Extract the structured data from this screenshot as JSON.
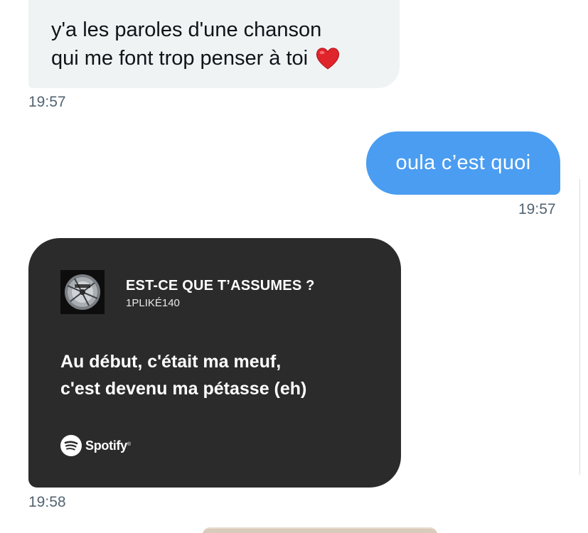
{
  "messages": [
    {
      "direction": "incoming",
      "lines": [
        "y'a les paroles d'une chanson",
        "qui me font trop penser à toi"
      ],
      "emoji": "heart-icon",
      "time": "19:57"
    },
    {
      "direction": "outgoing",
      "text": "oula c’est quoi",
      "time": "19:57"
    },
    {
      "direction": "incoming",
      "type": "spotify-lyrics-card",
      "track_title": "EST-CE QUE T’ASSUMES ?",
      "artist": "1PLIKÉ140",
      "lyrics": [
        "Au début, c'était ma meuf,",
        "c'est devenu ma pétasse (eh)"
      ],
      "brand": "Spotify",
      "brand_mark": "®",
      "time": "19:58"
    }
  ],
  "colors": {
    "incoming_bubble": "#eff3f4",
    "outgoing_bubble": "#4a9df1",
    "card_background": "#2b2b2b",
    "timestamp": "#536471",
    "heart": "#e0242b"
  }
}
